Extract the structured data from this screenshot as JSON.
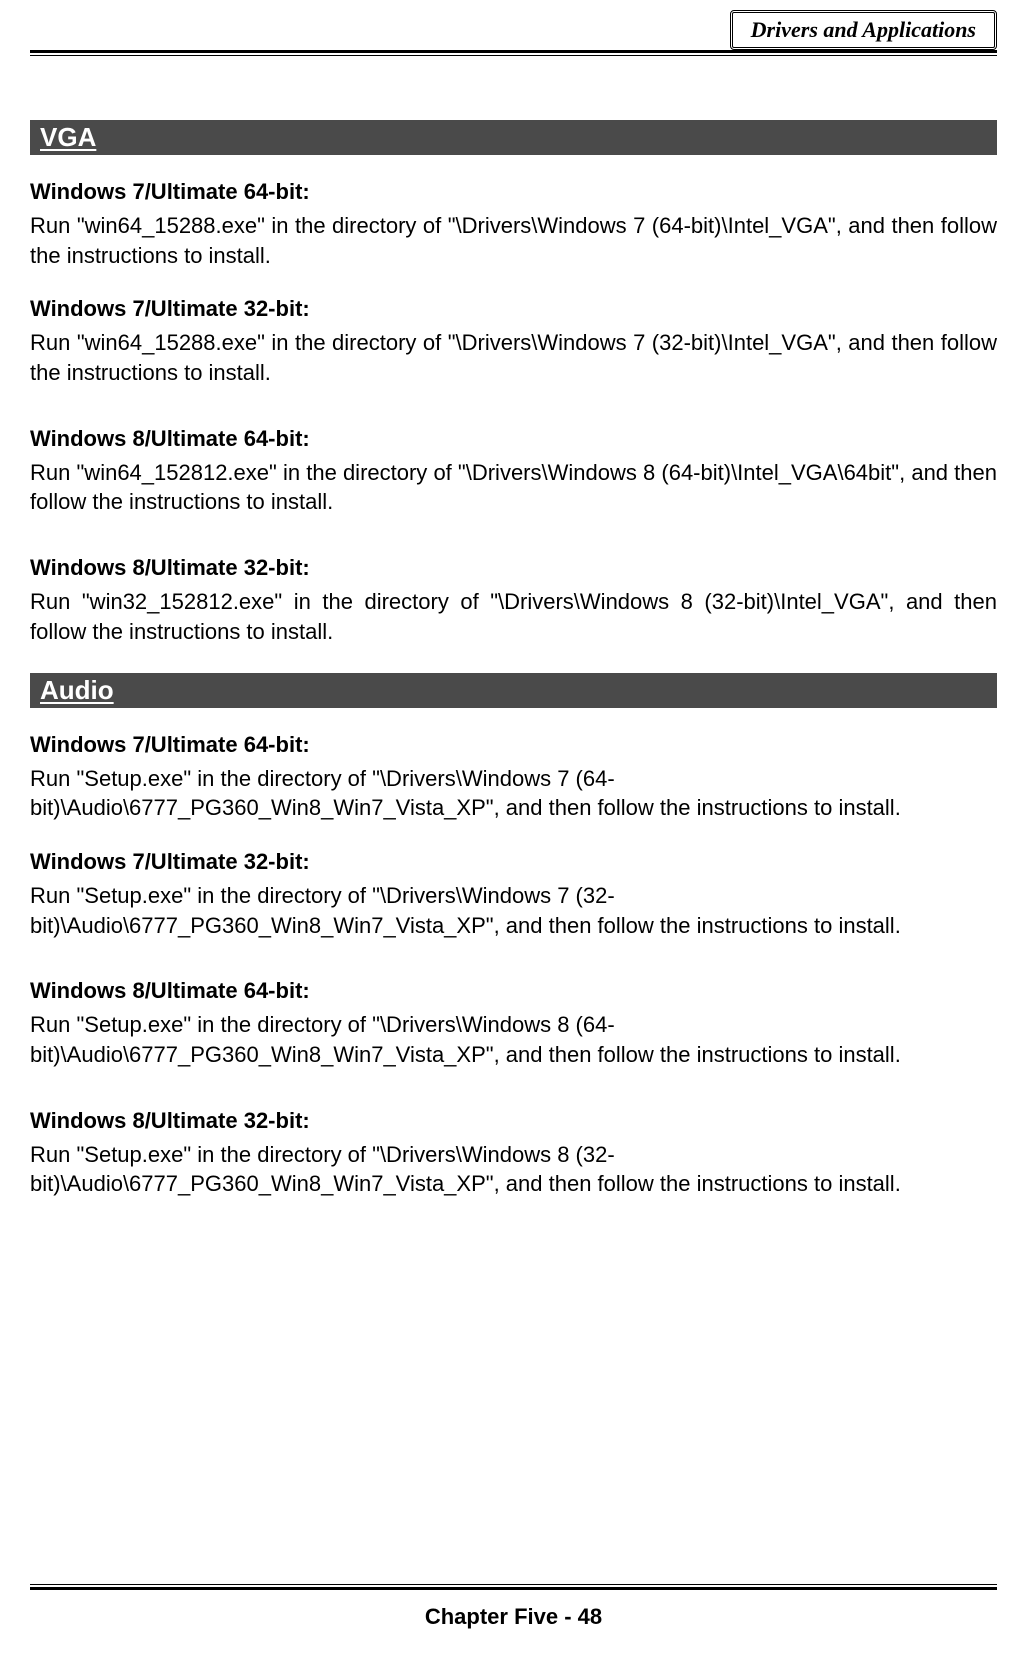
{
  "header": {
    "badge": "Drivers and Applications"
  },
  "sections": [
    {
      "title": "VGA",
      "entries": [
        {
          "heading": "Windows 7/Ultimate 64-bit:",
          "body": "Run \"win64_15288.exe\" in the directory of \"\\Drivers\\Windows 7 (64-bit)\\Intel_VGA\", and then follow the instructions to install.",
          "justify": true
        },
        {
          "heading": "Windows 7/Ultimate 32-bit:",
          "body": "Run \"win64_15288.exe\" in the directory of \"\\Drivers\\Windows 7 (32-bit)\\Intel_VGA\", and then follow the instructions to install.",
          "justify": true
        },
        {
          "heading": "Windows 8/Ultimate 64-bit:",
          "body": "Run \"win64_152812.exe\" in the directory of \"\\Drivers\\Windows 8 (64-bit)\\Intel_VGA\\64bit\", and then follow the instructions to install.",
          "justify": true
        },
        {
          "heading": "Windows 8/Ultimate 32-bit:",
          "body": "Run \"win32_152812.exe\" in the directory of \"\\Drivers\\Windows 8 (32-bit)\\Intel_VGA\", and then follow the instructions to install.",
          "justify": true
        }
      ]
    },
    {
      "title": "Audio",
      "entries": [
        {
          "heading": "Windows 7/Ultimate 64-bit:",
          "body": "Run \"Setup.exe\" in the directory of \"\\Drivers\\Windows 7 (64-bit)\\Audio\\6777_PG360_Win8_Win7_Vista_XP\", and then follow the instructions to install.",
          "justify": false
        },
        {
          "heading": "Windows 7/Ultimate 32-bit:",
          "body": "Run \"Setup.exe\" in the directory of \"\\Drivers\\Windows 7 (32-bit)\\Audio\\6777_PG360_Win8_Win7_Vista_XP\", and then follow the instructions to install.",
          "justify": false
        },
        {
          "heading": "Windows 8/Ultimate 64-bit:",
          "body": "Run \"Setup.exe\" in the directory of \"\\Drivers\\Windows 8 (64-bit)\\Audio\\6777_PG360_Win8_Win7_Vista_XP\", and then follow the instructions to install.",
          "justify": false
        },
        {
          "heading": "Windows 8/Ultimate 32-bit:",
          "body": "Run \"Setup.exe\" in the directory of \"\\Drivers\\Windows 8 (32-bit)\\Audio\\6777_PG360_Win8_Win7_Vista_XP\", and then follow the instructions to install.",
          "justify": false
        }
      ]
    }
  ],
  "footer": {
    "text": "Chapter Five - 48"
  }
}
